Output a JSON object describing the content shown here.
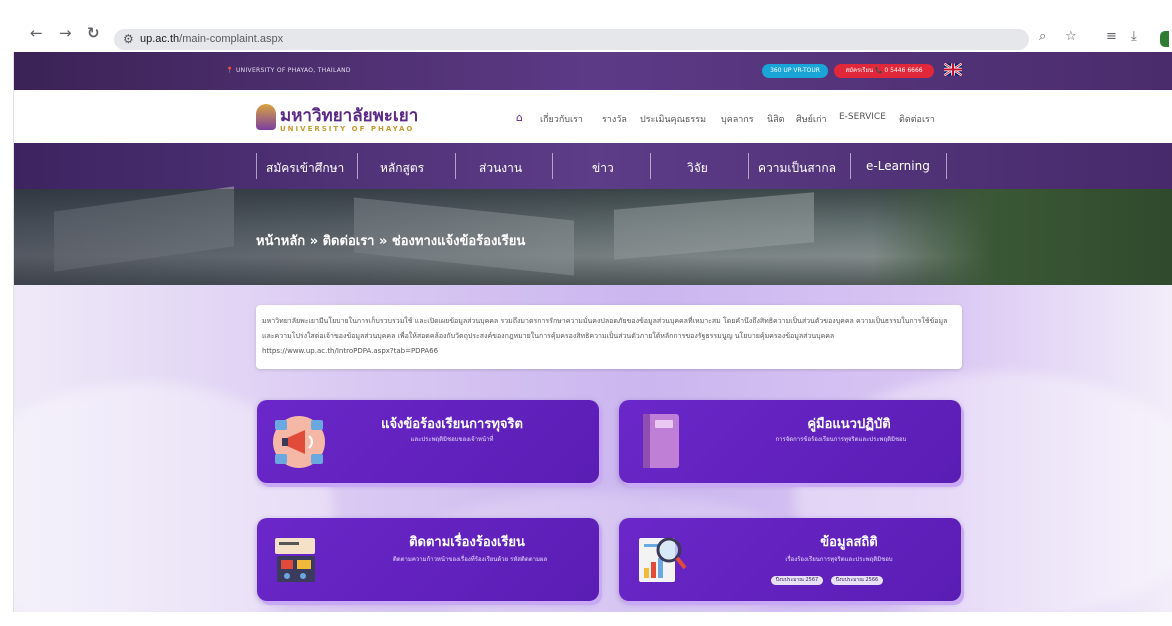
{
  "browser": {
    "url_host": "up.ac.th",
    "url_path": "/main-complaint.aspx",
    "back_icon": "arrow-left-icon",
    "forward_icon": "arrow-right-icon",
    "reload_icon": "reload-icon"
  },
  "topbar": {
    "address": "UNIVERSITY OF PHAYAO, THAILAND",
    "tour_button": "360 UP VR-TOUR",
    "phone_button": "สมัครเรียน 📞 0 5446 6666"
  },
  "header": {
    "logo_th": "มหาวิทยาลัยพะเยา",
    "logo_en": "UNIVERSITY OF PHAYAO",
    "nav": [
      "เกี่ยวกับเรา",
      "รางวัล",
      "ประเมินคุณธรรม",
      "บุคลากร",
      "นิสิต",
      "ศิษย์เก่า",
      "E-SERVICE",
      "ติดต่อเรา"
    ]
  },
  "menu": [
    "สมัครเข้าศึกษา",
    "หลักสูตร",
    "ส่วนงาน",
    "ข่าว",
    "วิจัย",
    "ความเป็นสากล",
    "e-Learning"
  ],
  "breadcrumb": "หน้าหลัก » ติดต่อเรา » ช่องทางแจ้งข้อร้องเรียน",
  "notice": "มหาวิทยาลัยพะเยามีนโยบายในการเก็บรวบรวมใช้ และเปิดเผยข้อมูลส่วนบุคคล รวมถึงมาตรการรักษาความมั่นคงปลอดภัยของข้อมูลส่วนบุคคลที่เหมาะสม โดยคำนึงถึงสิทธิความเป็นส่วนตัวของบุคคล ความเป็นธรรมในการใช้ข้อมูลและความโปร่งใสต่อเจ้าของข้อมูลส่วนบุคคล เพื่อให้สอดคล้องกับวัตถุประสงค์ของกฎหมายในการคุ้มครองสิทธิความเป็นส่วนตัวภายใต้หลักการของรัฐธรรมนูญ นโยบายคุ้มครองข้อมูลส่วนบุคคล https://www.up.ac.th/IntroPDPA.aspx?tab=PDPA66",
  "cards": [
    {
      "title": "แจ้งข้อร้องเรียนการทุจริต",
      "subtitle": "และประพฤติมิชอบของเจ้าหน้าที่",
      "icon": "megaphone-icon"
    },
    {
      "title": "คู่มือแนวปฏิบัติ",
      "subtitle": "การจัดการข้อร้องเรียนการทุจริตและประพฤติมิชอบ",
      "icon": "book-icon"
    },
    {
      "title": "ติดตามเรื่องร้องเรียน",
      "subtitle": "ติดตามความก้าวหน้าของเรื่องที่ร้องเรียนด้วย รหัสติดตามผล",
      "icon": "tracking-icon"
    },
    {
      "title": "ข้อมูลสถิติ",
      "subtitle": "เรื่องร้องเรียนการทุจริตและประพฤติมิชอบ",
      "icon": "statistics-icon",
      "tags": [
        "ปีงบประมาณ 2567",
        "ปีงบประมาณ 2566"
      ]
    }
  ],
  "colors": {
    "brand_purple": "#5b2a86",
    "card_purple": "#6b27c9",
    "tour_blue": "#19a5d8",
    "phone_red": "#e0283a"
  }
}
